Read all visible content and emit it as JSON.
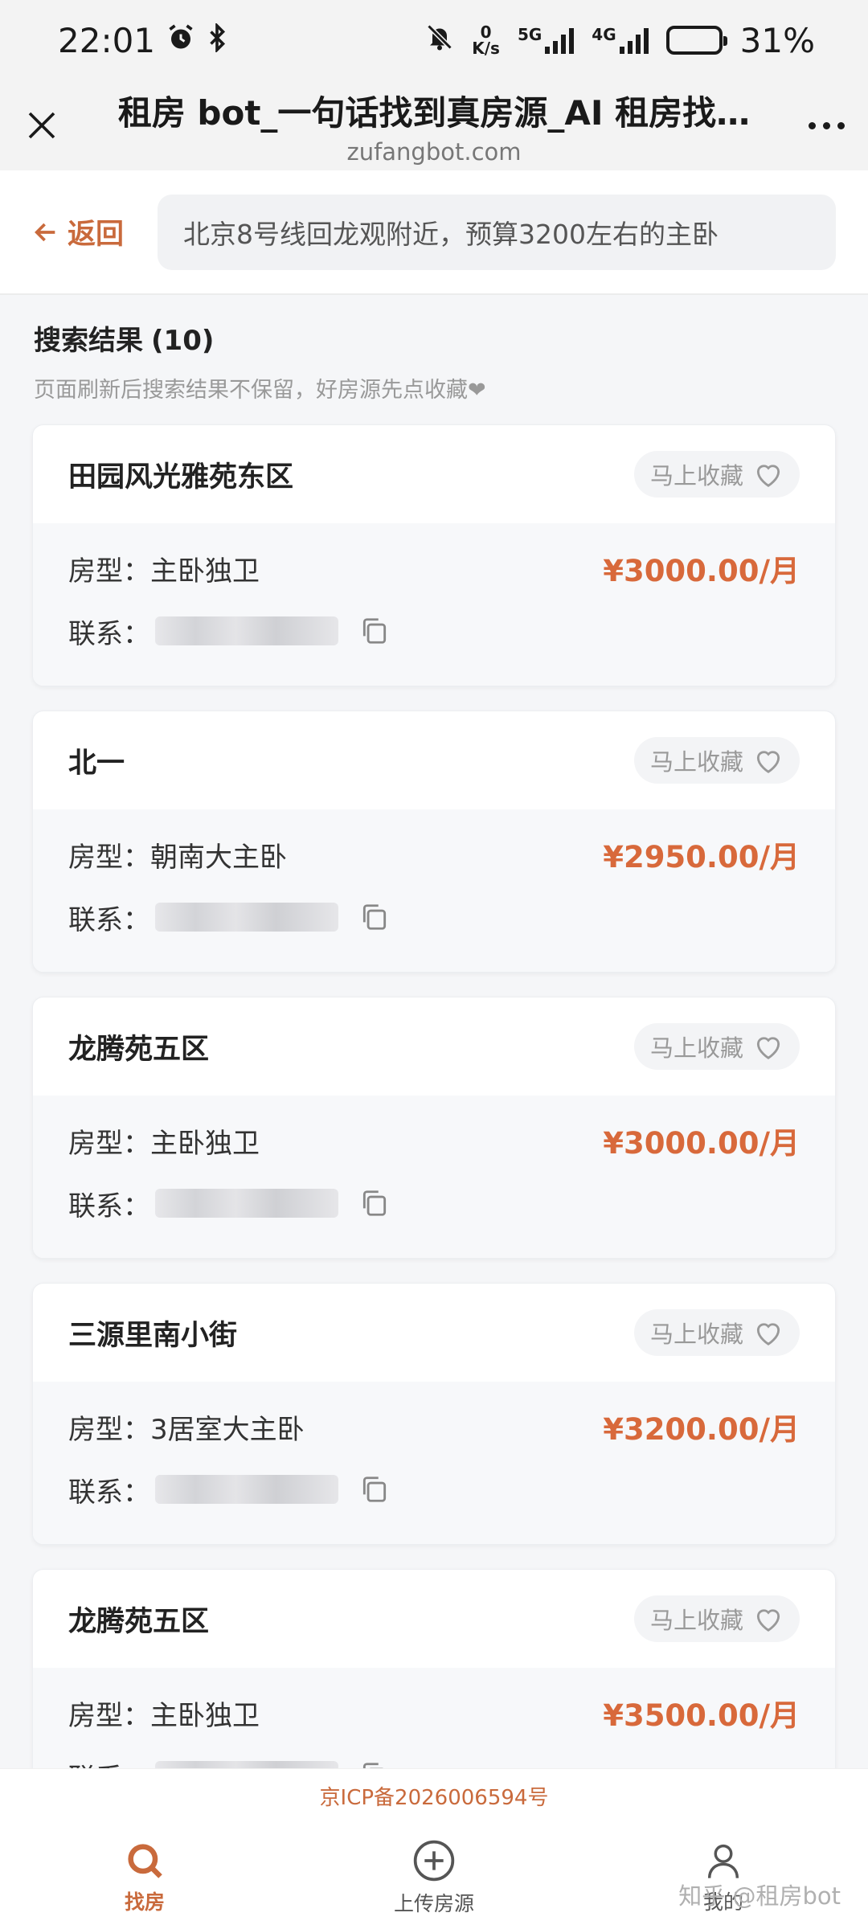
{
  "status_bar": {
    "time": "22:01",
    "net_speed_value": "0",
    "net_speed_unit": "K/s",
    "net1": "5G",
    "net2": "4G",
    "battery": "31%",
    "battery_level_percent": 31
  },
  "browser": {
    "title": "租房 bot_一句话找到真房源_AI 租房找…",
    "url": "zufangbot.com",
    "icons": {
      "close": "close-icon",
      "more": "more-icon"
    }
  },
  "header": {
    "back_label": "返回",
    "search_value": "北京8号线回龙观附近，预算3200左右的主卧"
  },
  "results": {
    "title": "搜索结果",
    "count": "(10)",
    "note": "页面刷新后搜索结果不保留，好房源先点收藏❤"
  },
  "listings": [
    {
      "name": "田园风光雅苑东区",
      "fav_label": "马上收藏",
      "type_label": "房型：",
      "type": "主卧独卫",
      "price": "¥3000.00/月",
      "contact_label": "联系："
    },
    {
      "name": "北一",
      "fav_label": "马上收藏",
      "type_label": "房型：",
      "type": "朝南大主卧",
      "price": "¥2950.00/月",
      "contact_label": "联系："
    },
    {
      "name": "龙腾苑五区",
      "fav_label": "马上收藏",
      "type_label": "房型：",
      "type": "主卧独卫",
      "price": "¥3000.00/月",
      "contact_label": "联系："
    },
    {
      "name": "三源里南小街",
      "fav_label": "马上收藏",
      "type_label": "房型：",
      "type": "3居室大主卧",
      "price": "¥3200.00/月",
      "contact_label": "联系："
    },
    {
      "name": "龙腾苑五区",
      "fav_label": "马上收藏",
      "type_label": "房型：",
      "type": "主卧独卫",
      "price": "¥3500.00/月",
      "contact_label": "联系："
    }
  ],
  "footer": {
    "icp": "京ICP备2026006594号",
    "tabs": [
      {
        "label": "找房",
        "icon": "search-icon"
      },
      {
        "label": "上传房源",
        "icon": "add-circle-icon"
      },
      {
        "label": "我的",
        "icon": "user-icon"
      }
    ],
    "watermark": "知乎 @租房bot"
  },
  "colors": {
    "accent": "#c96a3c",
    "price": "#d8693b"
  }
}
